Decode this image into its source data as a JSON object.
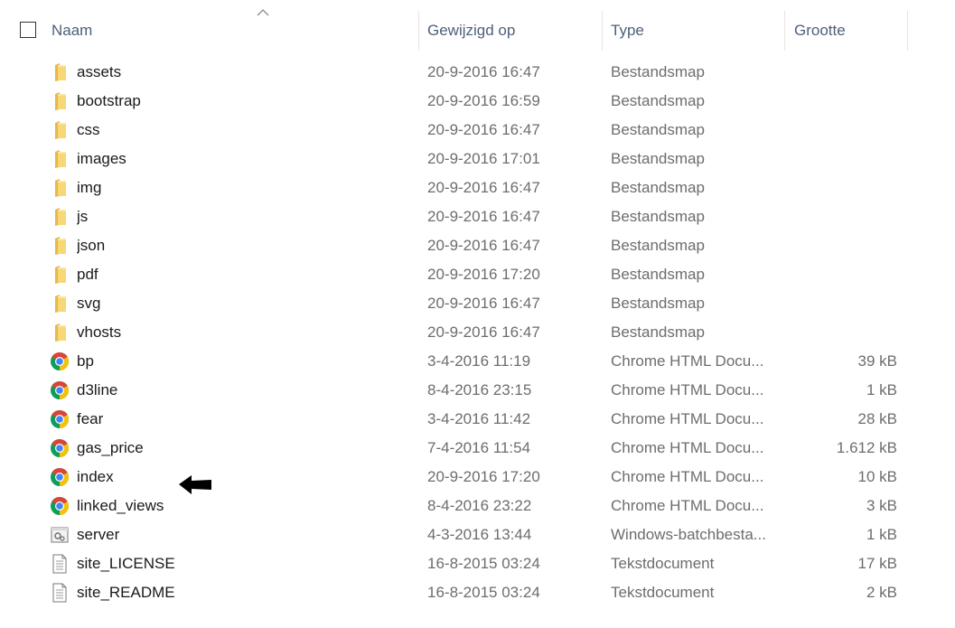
{
  "columns": {
    "name": "Naam",
    "modified": "Gewijzigd op",
    "type": "Type",
    "size": "Grootte"
  },
  "sort": {
    "column": "name",
    "icon": "sort-ascending-icon"
  },
  "files": [
    {
      "name": "assets",
      "date": "20-9-2016 16:47",
      "type": "Bestandsmap",
      "size": "",
      "icon": "folder-icon"
    },
    {
      "name": "bootstrap",
      "date": "20-9-2016 16:59",
      "type": "Bestandsmap",
      "size": "",
      "icon": "folder-icon"
    },
    {
      "name": "css",
      "date": "20-9-2016 16:47",
      "type": "Bestandsmap",
      "size": "",
      "icon": "folder-icon"
    },
    {
      "name": "images",
      "date": "20-9-2016 17:01",
      "type": "Bestandsmap",
      "size": "",
      "icon": "folder-icon"
    },
    {
      "name": "img",
      "date": "20-9-2016 16:47",
      "type": "Bestandsmap",
      "size": "",
      "icon": "folder-icon"
    },
    {
      "name": "js",
      "date": "20-9-2016 16:47",
      "type": "Bestandsmap",
      "size": "",
      "icon": "folder-icon"
    },
    {
      "name": "json",
      "date": "20-9-2016 16:47",
      "type": "Bestandsmap",
      "size": "",
      "icon": "folder-icon"
    },
    {
      "name": "pdf",
      "date": "20-9-2016 17:20",
      "type": "Bestandsmap",
      "size": "",
      "icon": "folder-icon"
    },
    {
      "name": "svg",
      "date": "20-9-2016 16:47",
      "type": "Bestandsmap",
      "size": "",
      "icon": "folder-icon"
    },
    {
      "name": "vhosts",
      "date": "20-9-2016 16:47",
      "type": "Bestandsmap",
      "size": "",
      "icon": "folder-icon"
    },
    {
      "name": "bp",
      "date": "3-4-2016 11:19",
      "type": "Chrome HTML Docu...",
      "size": "39 kB",
      "icon": "chrome-icon"
    },
    {
      "name": "d3line",
      "date": "8-4-2016 23:15",
      "type": "Chrome HTML Docu...",
      "size": "1 kB",
      "icon": "chrome-icon"
    },
    {
      "name": "fear",
      "date": "3-4-2016 11:42",
      "type": "Chrome HTML Docu...",
      "size": "28 kB",
      "icon": "chrome-icon"
    },
    {
      "name": "gas_price",
      "date": "7-4-2016 11:54",
      "type": "Chrome HTML Docu...",
      "size": "1.612 kB",
      "icon": "chrome-icon"
    },
    {
      "name": "index",
      "date": "20-9-2016 17:20",
      "type": "Chrome HTML Docu...",
      "size": "10 kB",
      "icon": "chrome-icon"
    },
    {
      "name": "linked_views",
      "date": "8-4-2016 23:22",
      "type": "Chrome HTML Docu...",
      "size": "3 kB",
      "icon": "chrome-icon"
    },
    {
      "name": "server",
      "date": "4-3-2016 13:44",
      "type": "Windows-batchbesta...",
      "size": "1 kB",
      "icon": "batch-file-icon"
    },
    {
      "name": "site_LICENSE",
      "date": "16-8-2015 03:24",
      "type": "Tekstdocument",
      "size": "17 kB",
      "icon": "text-file-icon"
    },
    {
      "name": "site_README",
      "date": "16-8-2015 03:24",
      "type": "Tekstdocument",
      "size": "2 kB",
      "icon": "text-file-icon"
    }
  ],
  "annotation": {
    "icon": "black-arrow-icon",
    "points_to": "index"
  },
  "colors": {
    "header_text": "#4c607a",
    "name_text": "#1a1a1a",
    "detail_text": "#6d6d6d",
    "folder": "#f8d775",
    "chrome_red": "#db4437",
    "chrome_yellow": "#f4c20d",
    "chrome_green": "#0f9d58",
    "chrome_blue": "#4285f4"
  }
}
